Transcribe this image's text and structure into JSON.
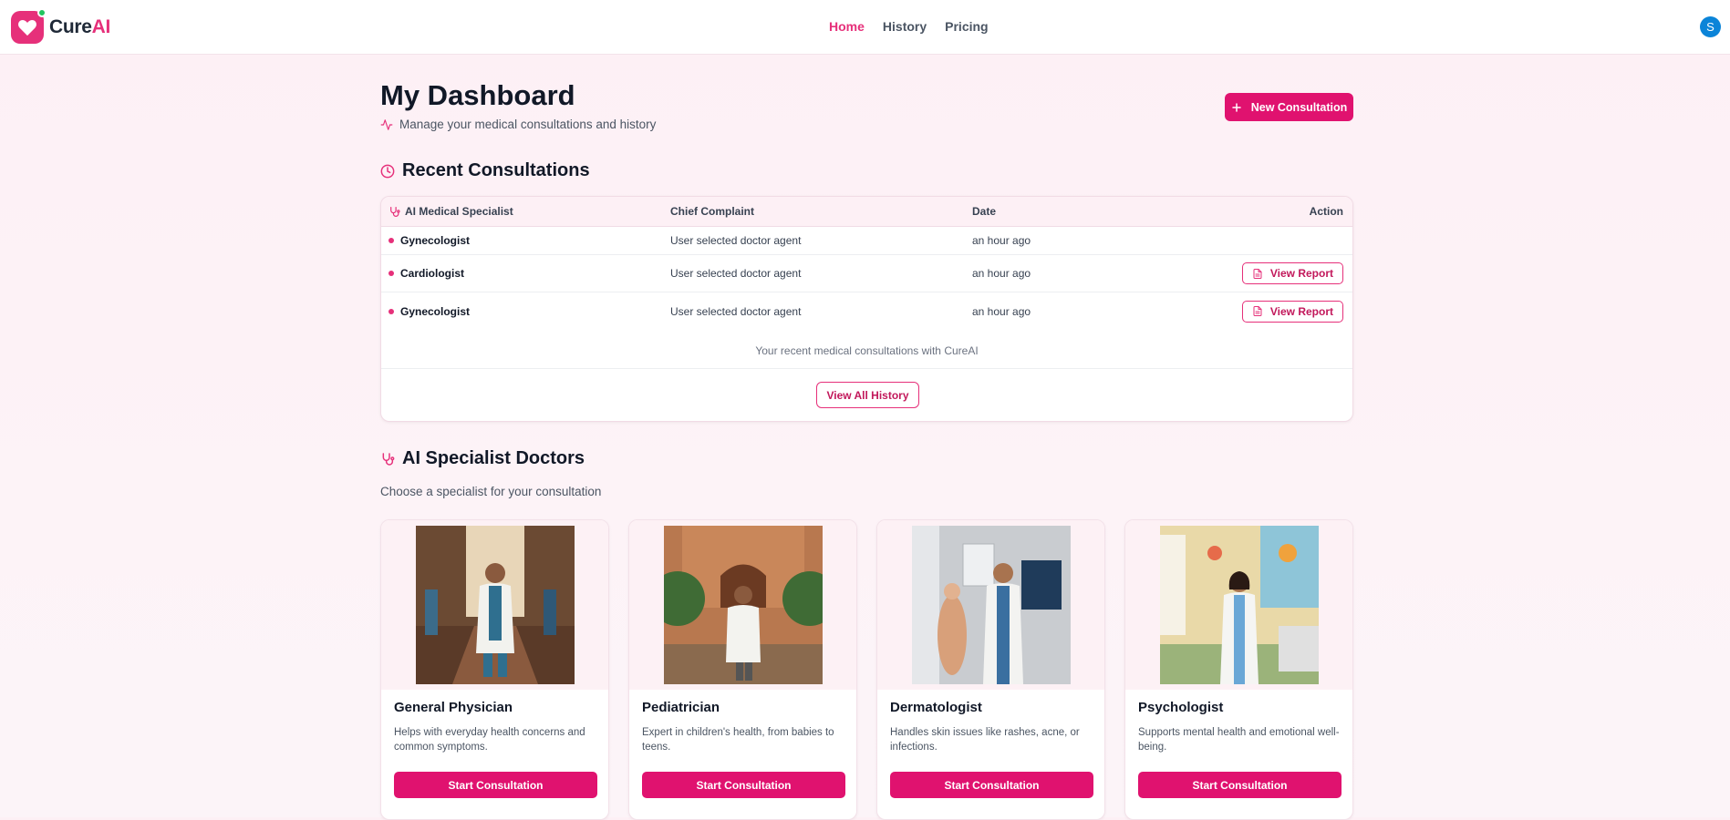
{
  "app": {
    "name_part1": "Cure",
    "name_part2": "AI"
  },
  "nav": {
    "items": [
      "Home",
      "History",
      "Pricing"
    ]
  },
  "user": {
    "avatar_initial": "S"
  },
  "dashboard": {
    "title": "My Dashboard",
    "subtitle": "Manage your medical consultations and history",
    "new_consultation_label": "New Consultation"
  },
  "recent": {
    "title": "Recent Consultations",
    "columns": [
      "AI Medical Specialist",
      "Chief Complaint",
      "Date",
      "Action"
    ],
    "rows": [
      {
        "specialist": "Gynecologist",
        "complaint": "User selected doctor agent",
        "date": "an hour ago",
        "action": ""
      },
      {
        "specialist": "Cardiologist",
        "complaint": "User selected doctor agent",
        "date": "an hour ago",
        "action": "View Report"
      },
      {
        "specialist": "Gynecologist",
        "complaint": "User selected doctor agent",
        "date": "an hour ago",
        "action": "View Report"
      }
    ],
    "caption": "Your recent medical consultations with CureAI",
    "view_all_label": "View All History"
  },
  "specialists": {
    "title": "AI Specialist Doctors",
    "subtitle": "Choose a specialist for your consultation",
    "cards": [
      {
        "name": "General Physician",
        "description": "Helps with everyday health concerns and common symptoms.",
        "button": "Start Consultation"
      },
      {
        "name": "Pediatrician",
        "description": "Expert in children's health, from babies to teens.",
        "button": "Start Consultation"
      },
      {
        "name": "Dermatologist",
        "description": "Handles skin issues like rashes, acne, or infections.",
        "button": "Start Consultation"
      },
      {
        "name": "Psychologist",
        "description": "Supports mental health and emotional well-being.",
        "button": "Start Consultation"
      }
    ]
  },
  "colors": {
    "brand": "#e6307a",
    "brand_dark": "#e0126f",
    "online": "#22c55e",
    "avatar": "#0b84d8"
  }
}
